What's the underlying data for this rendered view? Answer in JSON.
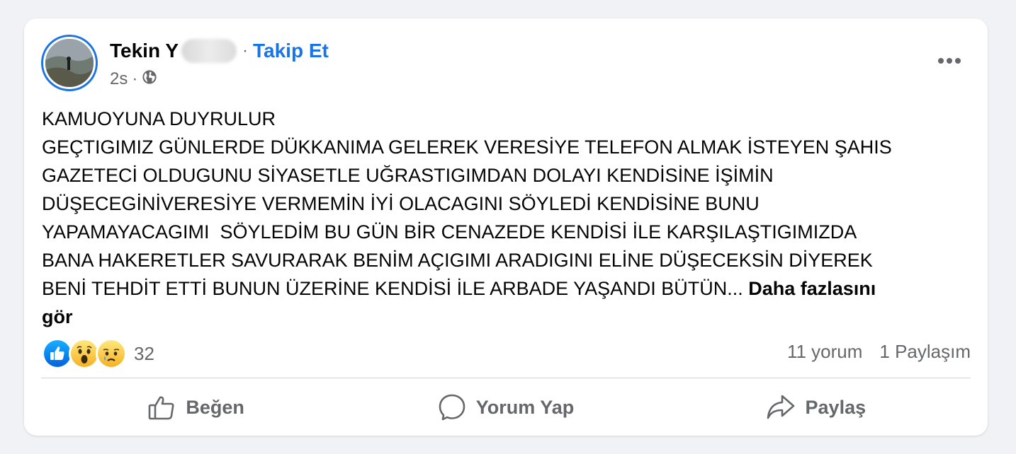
{
  "post": {
    "author_name": "Tekin Y",
    "separator": "·",
    "follow_label": "Takip Et",
    "time": "2s",
    "time_separator": "·",
    "privacy_icon": "globe-icon",
    "more_icon": "more-horizontal-icon",
    "text_lines": [
      "KAMUOYUNA DUYRULUR",
      "GEÇTIGIMIZ GÜNLERDE DÜKKANIMA GELEREK VERESİYE TELEFON ALMAK İSTEYEN ŞAHIS",
      "GAZETECİ OLDUGUNU SİYASETLE UĞRASTIGIMDAN DOLAYI KENDİSİNE İŞİMİN",
      "DÜŞECEGİNİVERESİYE VERMEMİN İYİ OLACAGINI SÖYLEDİ KENDİSİNE BUNU",
      "YAPAMAYACAGIMI  SÖYLEDİM BU GÜN BİR CENAZEDE KENDİSİ İLE KARŞILAŞTIGIMIZDA",
      "BANA HAKERETLER SAVURARAK BENİM AÇIGIMI ARADIGINI ELİNE DÜŞECEKSİN DİYEREK",
      "BENİ TEHDİT ETTİ BUNUN ÜZERİNE KENDİSİ İLE ARBADE YAŞANDI BÜTÜN..."
    ],
    "see_more_label": "Daha fazlasını gör"
  },
  "reactions": {
    "icons": [
      "like-icon",
      "wow-icon",
      "sad-icon"
    ],
    "count": "32"
  },
  "stats": {
    "comments": "11 yorum",
    "shares": "1 Paylaşım"
  },
  "actions": {
    "like_label": "Beğen",
    "comment_label": "Yorum Yap",
    "share_label": "Paylaş"
  },
  "colors": {
    "accent": "#1b74e4",
    "secondary_text": "#65676b",
    "background": "#f0f2f5"
  }
}
